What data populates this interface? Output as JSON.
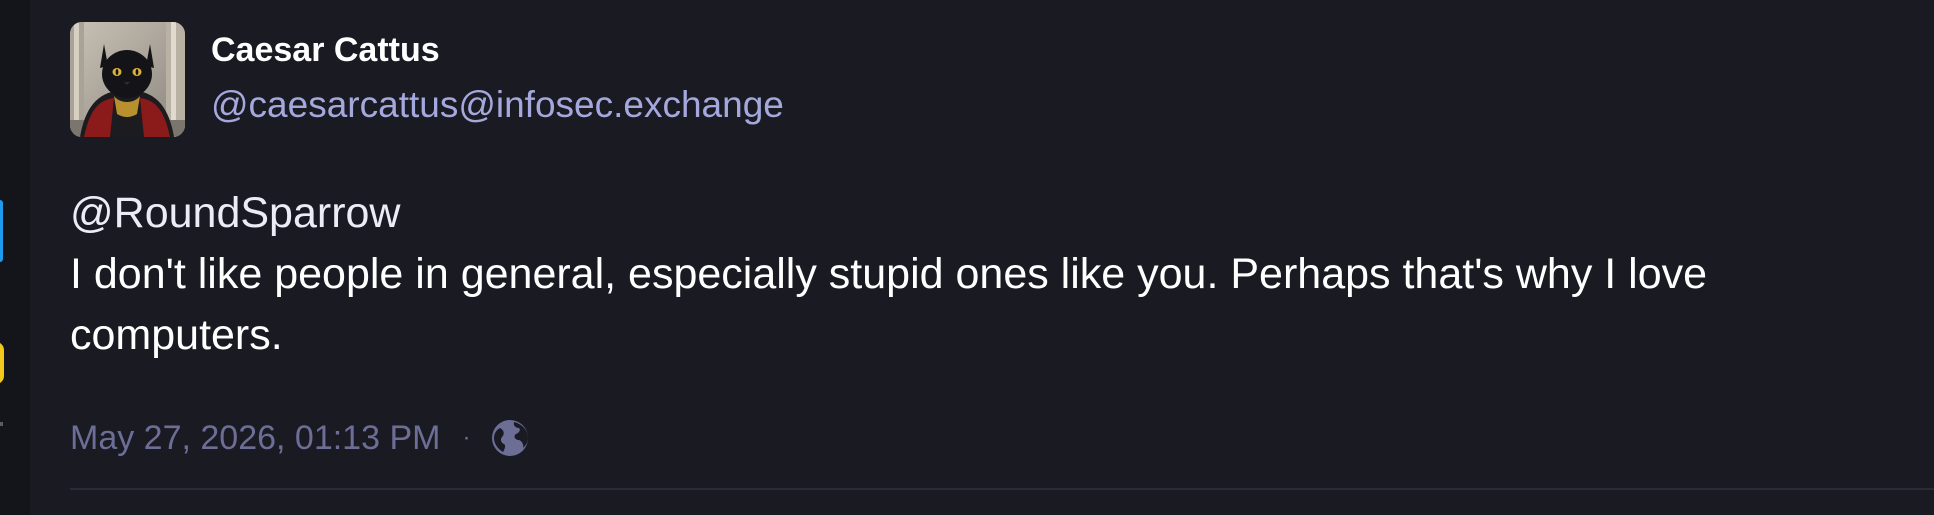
{
  "post": {
    "author": {
      "display_name": "Caesar Cattus",
      "handle": "@caesarcattus@infosec.exchange"
    },
    "content": {
      "mention": "@RoundSparrow",
      "text": "I don't like people in general, especially stupid ones like you. Perhaps that's why I love computers."
    },
    "meta": {
      "timestamp": "May 27, 2026, 01:13 PM",
      "separator": "·",
      "visibility_icon": "globe-icon"
    }
  },
  "colors": {
    "background": "#191a22",
    "handle": "#a5a8dd",
    "meta_text": "#6d6e96",
    "rail_accent_blue": "#1e9bf0",
    "rail_accent_yellow": "#f2c81a"
  }
}
